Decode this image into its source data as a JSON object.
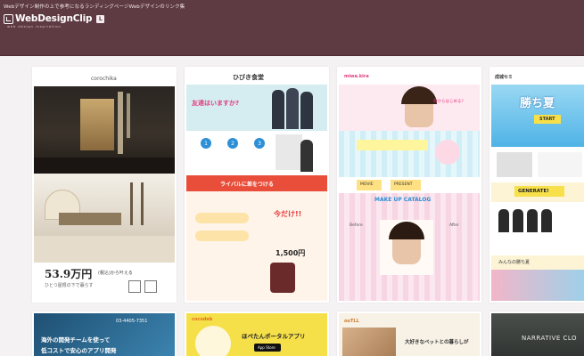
{
  "header": {
    "tagline": "Webデザイン制作の上で参考になるランディングページWebデザインのリンク集",
    "logo_text": "WebDesignClip",
    "logo_badge": "L",
    "logo_sub": "web design inspiration"
  },
  "cards": [
    {
      "brand": "corochika",
      "headline": "53.9万円",
      "headline_sub": "(税込)から叶える",
      "caption": "ひとつ屋根の下で暮らす"
    },
    {
      "brand": "ひびき食堂",
      "headline": "友達はいますか?",
      "step_labels": [
        "1",
        "2",
        "3"
      ],
      "banner": "ライバルに差をつける",
      "price": "1,500円",
      "cta": "今だけ!!"
    },
    {
      "brand": "miwa.kira",
      "headline": "何からはじめる?",
      "catalog": "MAKE UP CATALOG",
      "before": "Before",
      "after": "After",
      "tab_movie": "MOVIE",
      "tab_present": "PRESENT"
    },
    {
      "brand": "成城セミ",
      "headline": "勝ち夏",
      "cta": "START",
      "generate": "GENERATE!",
      "bottom": "みんなの勝ち夏"
    }
  ],
  "cards_bottom": [
    {
      "headline": "海外の開発チームを使って",
      "headline2": "低コストで安心のアプリ開発",
      "phone": "03-4405-7351"
    },
    {
      "brand": "cocodeb",
      "headline": "ほぺたんポータルアプリ",
      "store": "App Store"
    },
    {
      "brand": "ouTLL",
      "headline": "大好きなペットとの暮らしが"
    },
    {
      "headline": "NARRATIVE CLO"
    }
  ],
  "colors": {
    "header_bg": "#5e3a42",
    "page_bg": "#f4f2f2",
    "accent_pink": "#e43b7c",
    "accent_blue": "#2d8fd6"
  }
}
